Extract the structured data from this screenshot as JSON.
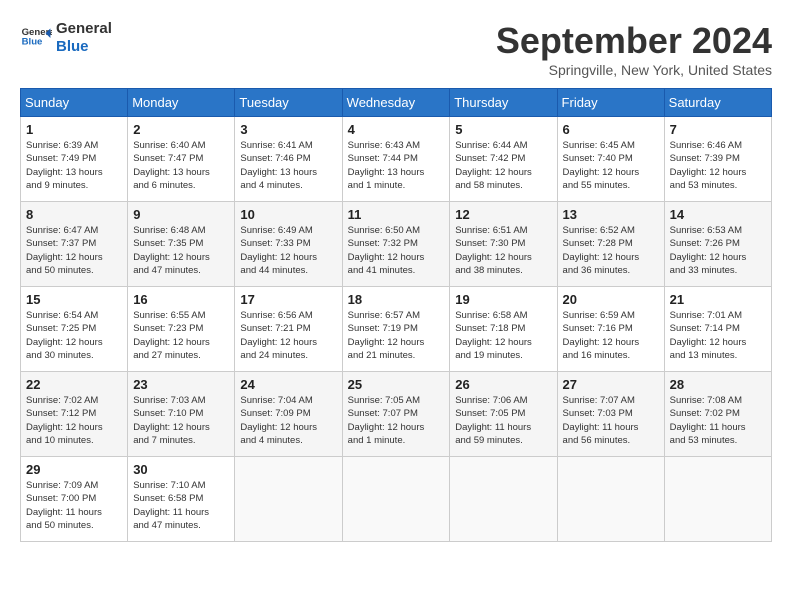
{
  "header": {
    "logo_line1": "General",
    "logo_line2": "Blue",
    "month_title": "September 2024",
    "location": "Springville, New York, United States"
  },
  "weekdays": [
    "Sunday",
    "Monday",
    "Tuesday",
    "Wednesday",
    "Thursday",
    "Friday",
    "Saturday"
  ],
  "weeks": [
    [
      {
        "day": "1",
        "info": "Sunrise: 6:39 AM\nSunset: 7:49 PM\nDaylight: 13 hours\nand 9 minutes."
      },
      {
        "day": "2",
        "info": "Sunrise: 6:40 AM\nSunset: 7:47 PM\nDaylight: 13 hours\nand 6 minutes."
      },
      {
        "day": "3",
        "info": "Sunrise: 6:41 AM\nSunset: 7:46 PM\nDaylight: 13 hours\nand 4 minutes."
      },
      {
        "day": "4",
        "info": "Sunrise: 6:43 AM\nSunset: 7:44 PM\nDaylight: 13 hours\nand 1 minute."
      },
      {
        "day": "5",
        "info": "Sunrise: 6:44 AM\nSunset: 7:42 PM\nDaylight: 12 hours\nand 58 minutes."
      },
      {
        "day": "6",
        "info": "Sunrise: 6:45 AM\nSunset: 7:40 PM\nDaylight: 12 hours\nand 55 minutes."
      },
      {
        "day": "7",
        "info": "Sunrise: 6:46 AM\nSunset: 7:39 PM\nDaylight: 12 hours\nand 53 minutes."
      }
    ],
    [
      {
        "day": "8",
        "info": "Sunrise: 6:47 AM\nSunset: 7:37 PM\nDaylight: 12 hours\nand 50 minutes."
      },
      {
        "day": "9",
        "info": "Sunrise: 6:48 AM\nSunset: 7:35 PM\nDaylight: 12 hours\nand 47 minutes."
      },
      {
        "day": "10",
        "info": "Sunrise: 6:49 AM\nSunset: 7:33 PM\nDaylight: 12 hours\nand 44 minutes."
      },
      {
        "day": "11",
        "info": "Sunrise: 6:50 AM\nSunset: 7:32 PM\nDaylight: 12 hours\nand 41 minutes."
      },
      {
        "day": "12",
        "info": "Sunrise: 6:51 AM\nSunset: 7:30 PM\nDaylight: 12 hours\nand 38 minutes."
      },
      {
        "day": "13",
        "info": "Sunrise: 6:52 AM\nSunset: 7:28 PM\nDaylight: 12 hours\nand 36 minutes."
      },
      {
        "day": "14",
        "info": "Sunrise: 6:53 AM\nSunset: 7:26 PM\nDaylight: 12 hours\nand 33 minutes."
      }
    ],
    [
      {
        "day": "15",
        "info": "Sunrise: 6:54 AM\nSunset: 7:25 PM\nDaylight: 12 hours\nand 30 minutes."
      },
      {
        "day": "16",
        "info": "Sunrise: 6:55 AM\nSunset: 7:23 PM\nDaylight: 12 hours\nand 27 minutes."
      },
      {
        "day": "17",
        "info": "Sunrise: 6:56 AM\nSunset: 7:21 PM\nDaylight: 12 hours\nand 24 minutes."
      },
      {
        "day": "18",
        "info": "Sunrise: 6:57 AM\nSunset: 7:19 PM\nDaylight: 12 hours\nand 21 minutes."
      },
      {
        "day": "19",
        "info": "Sunrise: 6:58 AM\nSunset: 7:18 PM\nDaylight: 12 hours\nand 19 minutes."
      },
      {
        "day": "20",
        "info": "Sunrise: 6:59 AM\nSunset: 7:16 PM\nDaylight: 12 hours\nand 16 minutes."
      },
      {
        "day": "21",
        "info": "Sunrise: 7:01 AM\nSunset: 7:14 PM\nDaylight: 12 hours\nand 13 minutes."
      }
    ],
    [
      {
        "day": "22",
        "info": "Sunrise: 7:02 AM\nSunset: 7:12 PM\nDaylight: 12 hours\nand 10 minutes."
      },
      {
        "day": "23",
        "info": "Sunrise: 7:03 AM\nSunset: 7:10 PM\nDaylight: 12 hours\nand 7 minutes."
      },
      {
        "day": "24",
        "info": "Sunrise: 7:04 AM\nSunset: 7:09 PM\nDaylight: 12 hours\nand 4 minutes."
      },
      {
        "day": "25",
        "info": "Sunrise: 7:05 AM\nSunset: 7:07 PM\nDaylight: 12 hours\nand 1 minute."
      },
      {
        "day": "26",
        "info": "Sunrise: 7:06 AM\nSunset: 7:05 PM\nDaylight: 11 hours\nand 59 minutes."
      },
      {
        "day": "27",
        "info": "Sunrise: 7:07 AM\nSunset: 7:03 PM\nDaylight: 11 hours\nand 56 minutes."
      },
      {
        "day": "28",
        "info": "Sunrise: 7:08 AM\nSunset: 7:02 PM\nDaylight: 11 hours\nand 53 minutes."
      }
    ],
    [
      {
        "day": "29",
        "info": "Sunrise: 7:09 AM\nSunset: 7:00 PM\nDaylight: 11 hours\nand 50 minutes."
      },
      {
        "day": "30",
        "info": "Sunrise: 7:10 AM\nSunset: 6:58 PM\nDaylight: 11 hours\nand 47 minutes."
      },
      {
        "day": "",
        "info": ""
      },
      {
        "day": "",
        "info": ""
      },
      {
        "day": "",
        "info": ""
      },
      {
        "day": "",
        "info": ""
      },
      {
        "day": "",
        "info": ""
      }
    ]
  ]
}
